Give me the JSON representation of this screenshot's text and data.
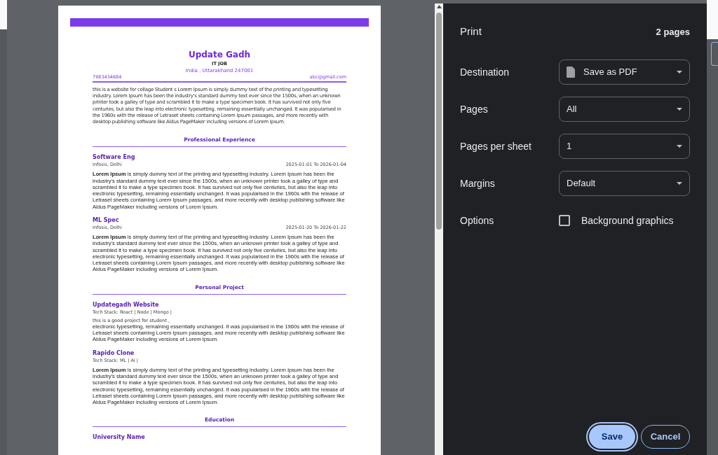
{
  "resume": {
    "name": "Update Gadh",
    "role": "IT JOB",
    "address": "India , Uttarakhand 247001",
    "phone": "7983434684",
    "email": "abc@gmail.com",
    "summary": "this is a website for collage Student s Lorem Ipsum is simply dummy text of the printing and typesetting industry. Lorem Ipsum has been the industry's standard dummy text ever since the 1500s, when an unknown printer took a galley of type and scrambled it to make a type specimen book. It has survived not only five centuries, but also the leap into electronic typesetting, remaining essentially unchanged. It was popularised in the 1960s with the release of Letraset sheets containing Lorem Ipsum passages, and more recently with desktop publishing software like Aldus PageMaker including versions of Lorem Ipsum.",
    "sections": [
      {
        "title": "Professional Experience",
        "entries": [
          {
            "title": "Software Eng",
            "subtitle": "Infosis, Delhi",
            "dates": "2025-01-01 To 2026-01-04",
            "description": "**Lorem Ipsum** is simply dummy text of the printing and typesetting industry. Lorem Ipsum has been the industry's standard dummy text ever since the 1500s, when an unknown printer took a galley of type and scrambled it to make a type specimen book. It has survived not only five centuries, but also the leap into electronic typesetting, remaining essentially unchanged. It was popularised in the 1960s with the release of Letraset sheets containing Lorem Ipsum passages, and more recently with desktop publishing software like Aldus PageMaker including versions of Lorem Ipsum."
          },
          {
            "title": "ML Spec",
            "subtitle": "Infosis, Delhi",
            "dates": "2025-01-20 To 2026-01-22",
            "description": "**Lorem Ipsum** is simply dummy text of the printing and typesetting industry. Lorem Ipsum has been the industry's standard dummy text ever since the 1500s, when an unknown printer took a galley of type and scrambled it to make a type specimen book. It has survived not only five centuries, but also the leap into electronic typesetting, remaining essentially unchanged. It was popularised in the 1960s with the release of Letraset sheets containing Lorem Ipsum passages, and more recently with desktop publishing software like Aldus PageMaker including versions of Lorem Ipsum."
          }
        ]
      },
      {
        "title": "Personal Project",
        "entries": [
          {
            "title": "Updategadh Website",
            "subtitle": "Tech Stack: React | Node | Mongo |",
            "note": "this is a good project for student ,",
            "description": "electronic typesetting, remaining essentially unchanged. It was popularised in the 1960s with the release of Letraset sheets containing Lorem Ipsum passages, and more recently with desktop publishing software like Aldus PageMaker including versions of Lorem Ipsum."
          },
          {
            "title": "Rapido Clone",
            "subtitle": "Tech Stack: ML | Ai |",
            "description": "**Lorem Ipsum** is simply dummy text of the printing and typesetting industry. Lorem Ipsum has been the industry's standard dummy text ever since the 1500s, when an unknown printer took a galley of type and scrambled it to make a type specimen book. It has survived not only five centuries, but also the leap into electronic typesetting, remaining essentially unchanged. It was popularised in the 1960s with the release of Letraset sheets containing Lorem Ipsum passages, and more recently with desktop publishing software like Aldus PageMaker including versions of Lorem Ipsum."
          }
        ]
      },
      {
        "title": "Education",
        "entries": [
          {
            "title": "University Name"
          }
        ]
      }
    ]
  },
  "print": {
    "title": "Print",
    "page_count": "2 pages",
    "settings": [
      {
        "kind": "file_select",
        "label": "Destination",
        "value": "Save as PDF"
      },
      {
        "kind": "select",
        "label": "Pages",
        "value": "All"
      },
      {
        "kind": "select",
        "label": "Pages per sheet",
        "value": "1"
      },
      {
        "kind": "select",
        "label": "Margins",
        "value": "Default"
      },
      {
        "kind": "checkbox",
        "label": "Options",
        "option": "Background graphics",
        "checked": false
      }
    ],
    "buttons": [
      {
        "label": "Save",
        "kind": "primary"
      },
      {
        "label": "Cancel",
        "kind": "secondary"
      }
    ]
  }
}
